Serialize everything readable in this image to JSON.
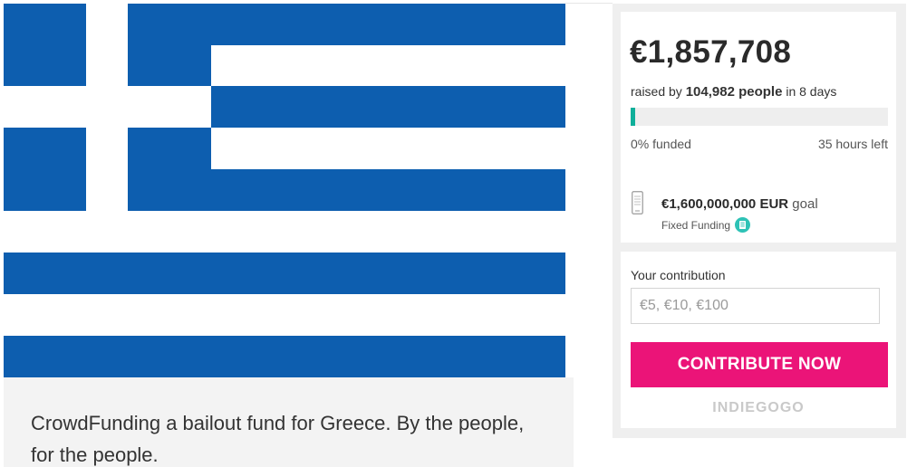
{
  "campaign": {
    "description": "CrowdFunding a bailout fund for Greece. By the people, for the people.",
    "flag_colors": {
      "blue": "#0d5eaf",
      "white": "#ffffff"
    }
  },
  "stats": {
    "amount_raised": "€1,857,708",
    "raised_prefix": "raised by",
    "backers": "104,982 people",
    "raised_suffix": "in 8 days",
    "funded_percent_label": "0% funded",
    "funded_fraction": 0.0012,
    "time_left": "35 hours left",
    "goal_amount": "€1,600,000,000",
    "goal_currency": "EUR",
    "goal_suffix": "goal",
    "funding_type": "Fixed Funding",
    "goal_icon": "phone-icon",
    "info_icon": "info-icon",
    "progress_color": "#0faf9a"
  },
  "contribution": {
    "label": "Your contribution",
    "placeholder": "€5, €10, €100",
    "button_label": "CONTRIBUTE NOW",
    "button_color": "#eb1478"
  },
  "branding": {
    "logo_text": "INDIEGOGO"
  }
}
